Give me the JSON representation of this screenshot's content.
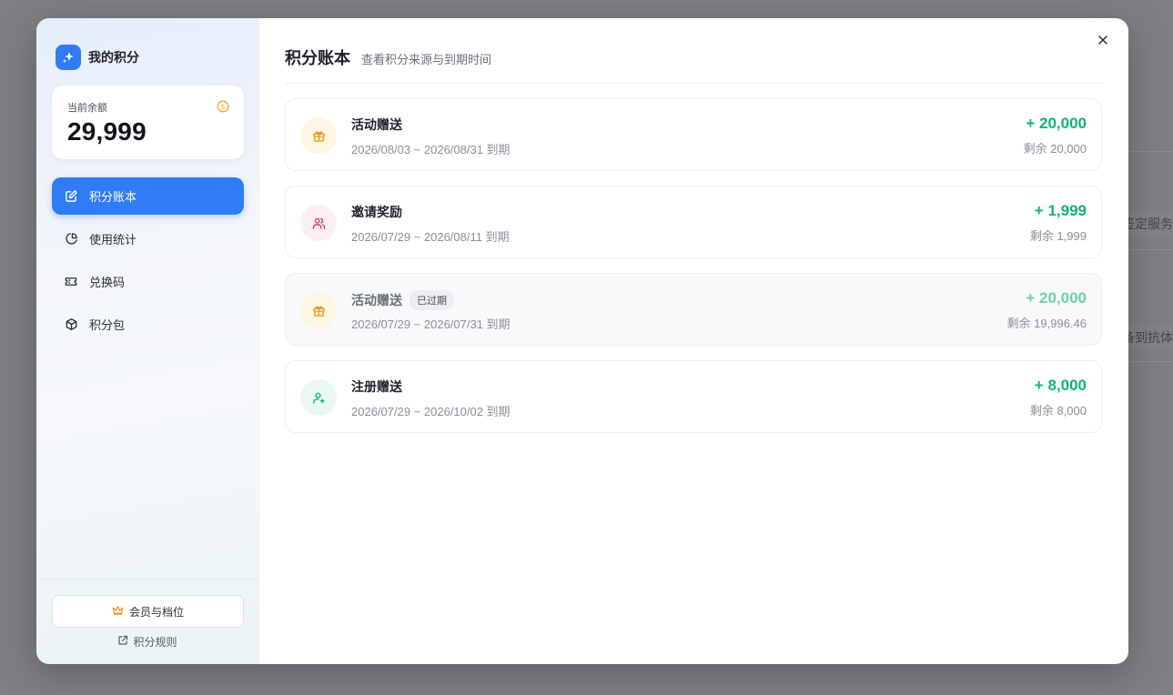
{
  "background": {
    "fragment_1": "签定服务",
    "fragment_2": "备到抗体"
  },
  "sidebar": {
    "brand_title": "我的积分",
    "balance_label": "当前余额",
    "balance_value": "29,999",
    "nav": [
      {
        "label": "积分账本",
        "icon": "edit-icon",
        "active": true
      },
      {
        "label": "使用统计",
        "icon": "pie-chart-icon",
        "active": false
      },
      {
        "label": "兑换码",
        "icon": "ticket-icon",
        "active": false
      },
      {
        "label": "积分包",
        "icon": "package-icon",
        "active": false
      }
    ],
    "member_button": "会员与档位",
    "rules_link": "积分规则"
  },
  "main": {
    "title": "积分账本",
    "subtitle": "查看积分来源与到期时间",
    "entries": [
      {
        "title": "活动赠送",
        "badge": "",
        "date": "2026/08/03 ~ 2026/08/31 到期",
        "amount": "+ 20,000",
        "remain": "剩余 20,000",
        "icon": "gift-icon"
      },
      {
        "title": "邀请奖励",
        "badge": "",
        "date": "2026/07/29 ~ 2026/08/11 到期",
        "amount": "+ 1,999",
        "remain": "剩余 1,999",
        "icon": "users-icon"
      },
      {
        "title": "活动赠送",
        "badge": "已过期",
        "date": "2026/07/29 ~ 2026/07/31 到期",
        "amount": "+ 20,000",
        "remain": "剩余 19,996.46",
        "icon": "gift-icon"
      },
      {
        "title": "注册赠送",
        "badge": "",
        "date": "2026/07/29 ~ 2026/10/02 到期",
        "amount": "+ 8,000",
        "remain": "剩余 8,000",
        "icon": "user-plus-icon"
      }
    ]
  },
  "colors": {
    "accent": "#2f7cf6",
    "positive": "#10b27a",
    "gift_bg": "#fdf6e3",
    "invite_bg": "#fdeef5",
    "register_bg": "#eaf8f1"
  }
}
